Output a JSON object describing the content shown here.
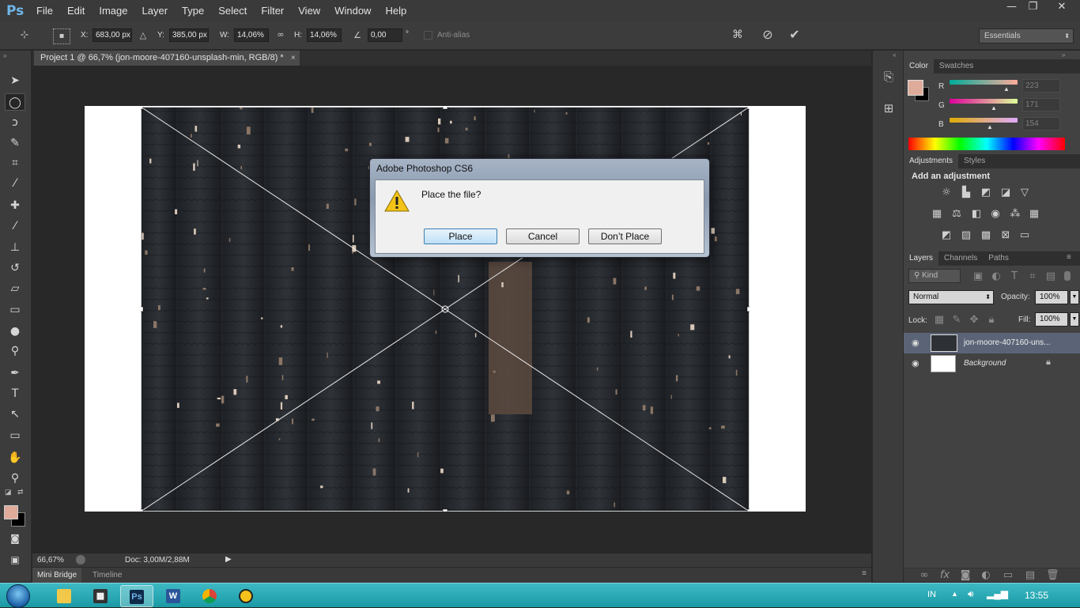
{
  "app": {
    "logo": "Ps"
  },
  "menu": [
    "File",
    "Edit",
    "Image",
    "Layer",
    "Type",
    "Select",
    "Filter",
    "View",
    "Window",
    "Help"
  ],
  "window_controls": {
    "minimize": "—",
    "restore": "❐",
    "close": "✕"
  },
  "options": {
    "x_label": "X:",
    "x_value": "683,00 px",
    "y_label": "Y:",
    "y_value": "385,00 px",
    "w_label": "W:",
    "w_value": "14,06%",
    "h_label": "H:",
    "h_value": "14,06%",
    "angle_value": "0,00",
    "angle_unit": "°",
    "antialias_label": "Anti-alias",
    "workspace": "Essentials"
  },
  "document": {
    "tab_title": "Project 1 @ 66,7% (jon-moore-407160-unsplash-min, RGB/8) *",
    "tab_close": "×",
    "zoom": "66,67%",
    "doc_info": "Doc: 3,00M/2,88M"
  },
  "bottom_tabs": [
    "Mini Bridge",
    "Timeline"
  ],
  "color_panel": {
    "tabs": [
      "Color",
      "Swatches"
    ],
    "channels": [
      {
        "label": "R",
        "value": "223"
      },
      {
        "label": "G",
        "value": "171"
      },
      {
        "label": "B",
        "value": "154"
      }
    ],
    "foreground": "#df ab9a",
    "fg_hex": "#dfab9a"
  },
  "adjustments_panel": {
    "tabs": [
      "Adjustments",
      "Styles"
    ],
    "heading": "Add an adjustment"
  },
  "layers_panel": {
    "tabs": [
      "Layers",
      "Channels",
      "Paths"
    ],
    "filter_kind": "Kind",
    "blend_mode": "Normal",
    "opacity_label": "Opacity:",
    "opacity_value": "100%",
    "lock_label": "Lock:",
    "fill_label": "Fill:",
    "fill_value": "100%",
    "layers": [
      {
        "name": "jon-moore-407160-uns...",
        "selected": true
      },
      {
        "name": "Background",
        "selected": false
      }
    ]
  },
  "dialog": {
    "title": "Adobe Photoshop CS6",
    "message": "Place the file?",
    "buttons": [
      "Place",
      "Cancel",
      "Don’t Place"
    ]
  },
  "taskbar": {
    "language": "IN",
    "clock": "13:55",
    "apps": [
      "file-explorer",
      "media-app",
      "photoshop",
      "word",
      "chrome",
      "other-app"
    ]
  },
  "colors": {
    "ps_blue": "#6fb5e8",
    "foreground_swatch": "#dfab9a",
    "background_swatch": "#000000",
    "taskbar": "#1fa6b1"
  }
}
